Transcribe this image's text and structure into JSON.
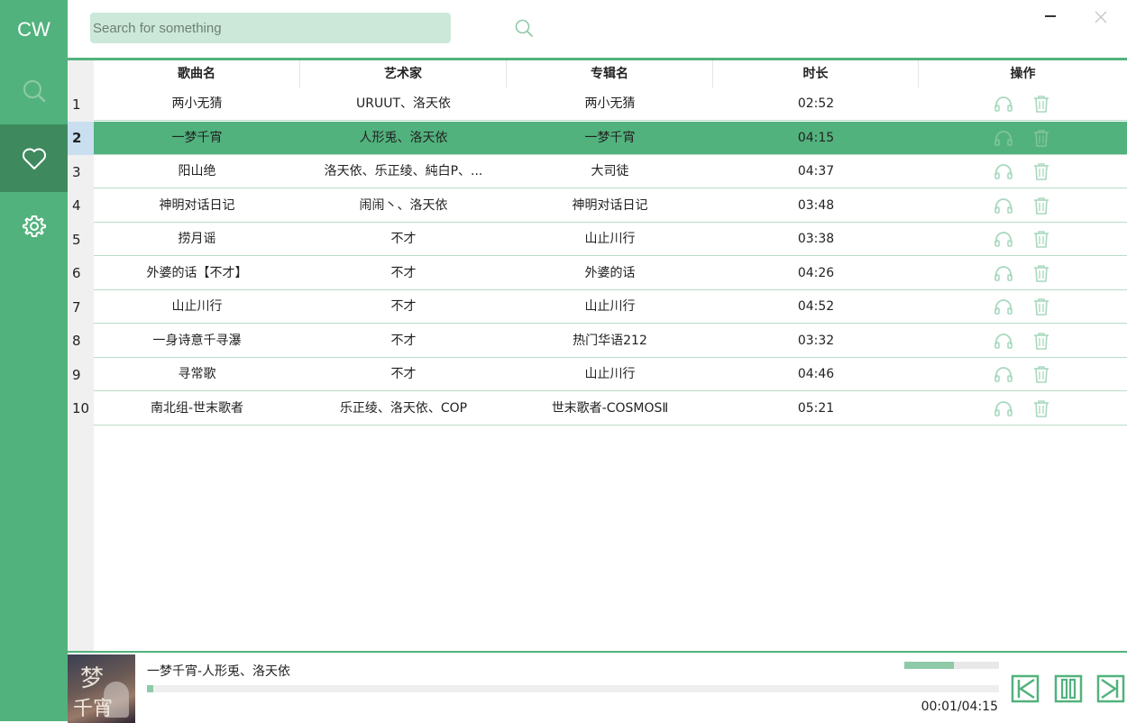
{
  "app": {
    "logo": "CW"
  },
  "sidebar": {
    "items": [
      {
        "icon": "search-icon",
        "active": false
      },
      {
        "icon": "heart-icon",
        "active": true
      },
      {
        "icon": "gear-icon",
        "active": false
      }
    ]
  },
  "search": {
    "placeholder": "Search for something",
    "value": ""
  },
  "table": {
    "headers": [
      "歌曲名",
      "艺术家",
      "专辑名",
      "时长",
      "操作"
    ],
    "selected_index": 2,
    "rows": [
      {
        "index": "1",
        "title": "两小无猜",
        "artist": "URUUT、洛天依",
        "album": "两小无猜",
        "duration": "02:52"
      },
      {
        "index": "2",
        "title": "一梦千宵",
        "artist": "人形兎、洛天依",
        "album": "一梦千宵",
        "duration": "04:15"
      },
      {
        "index": "3",
        "title": "阳山绝",
        "artist": "洛天依、乐正绫、純白P、...",
        "album": "大司徒",
        "duration": "04:37"
      },
      {
        "index": "4",
        "title": "神明对话日记",
        "artist": "闹闹丶、洛天依",
        "album": "神明对话日记",
        "duration": "03:48"
      },
      {
        "index": "5",
        "title": "捞月谣",
        "artist": "不才",
        "album": "山止川行",
        "duration": "03:38"
      },
      {
        "index": "6",
        "title": "外婆的话【不才】",
        "artist": "不才",
        "album": "外婆的话",
        "duration": "04:26"
      },
      {
        "index": "7",
        "title": "山止川行",
        "artist": "不才",
        "album": "山止川行",
        "duration": "04:52"
      },
      {
        "index": "8",
        "title": "一身诗意千寻瀑",
        "artist": "不才",
        "album": "热门华语212",
        "duration": "03:32"
      },
      {
        "index": "9",
        "title": "寻常歌",
        "artist": "不才",
        "album": "山止川行",
        "duration": "04:46"
      },
      {
        "index": "10",
        "title": "南北组-世末歌者",
        "artist": "乐正绫、洛天依、COP",
        "album": "世末歌者-COSMOSⅡ",
        "duration": "05:21"
      }
    ]
  },
  "player": {
    "track": "一梦千宵-人形兎、洛天依",
    "time": "00:01/04:15",
    "progress_fraction": 0.004,
    "volume_fraction": 0.52
  },
  "colors": {
    "accent": "#52b27d",
    "accent_dark": "#3e8a5e",
    "icon_muted": "#a8d8bd"
  }
}
